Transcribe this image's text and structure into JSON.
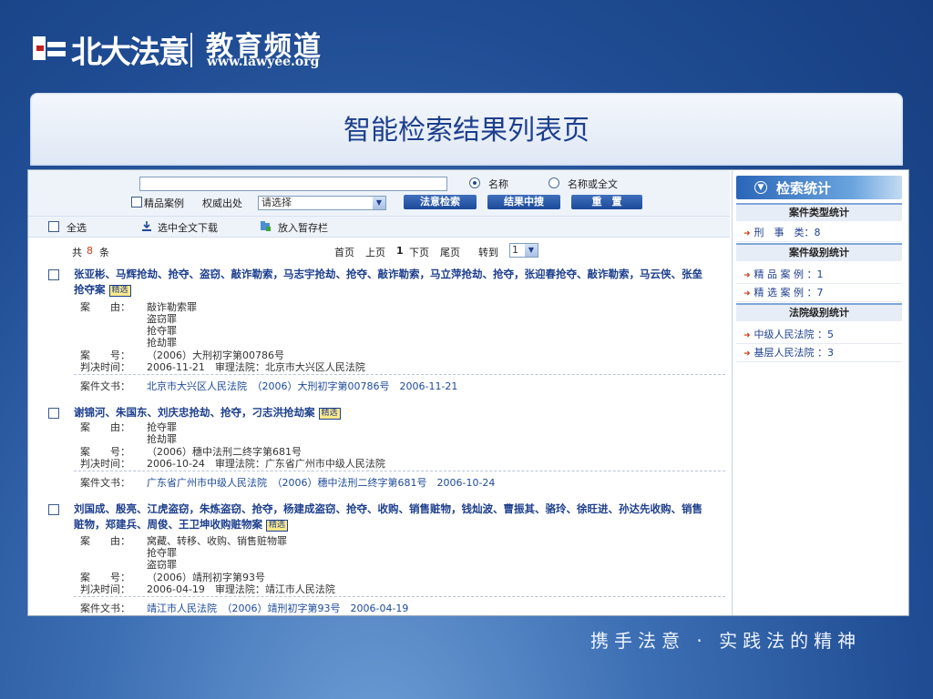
{
  "brand": {
    "name": "北大法意",
    "channel": "教育频道",
    "url": "www.lawyee.org"
  },
  "page_title": "智能检索结果列表页",
  "search": {
    "input_value": "",
    "radio_name": "名称",
    "radio_name_fulltext": "名称或全文",
    "premium_checkbox": "精品案例",
    "authority_label": "权威出处",
    "authority_select": "请选择",
    "btn_search": "法意检索",
    "btn_within": "结果中搜",
    "btn_reset": "重　置"
  },
  "toolbar": {
    "select_all": "全选",
    "download": "选中全文下载",
    "save": "放入暂存栏"
  },
  "pager": {
    "total_prefix": "共",
    "total": "8",
    "total_suffix": "条",
    "first": "首页",
    "prev": "上页",
    "current": "1",
    "next": "下页",
    "last": "尾页",
    "goto": "转到",
    "goto_value": "1"
  },
  "labels": {
    "cause": "案　　由：",
    "case_no": "案　　号：",
    "judge_time": "判决时间：",
    "court": "审理法院：",
    "document": "案件文书：",
    "tag": "精选"
  },
  "results": [
    {
      "title": "张亚彬、马辉抢劫、抢夺、盗窃、敲诈勒索，马志宇抢劫、抢夺、敲诈勒索，马立萍抢劫、抢夺，张迎春抢夺、敲诈勒索，马云侠、张垒抢夺案",
      "causes": [
        "敲诈勒索罪",
        "盗窃罪",
        "抢夺罪",
        "抢劫罪"
      ],
      "case_no": "（2006）大刑初字第00786号",
      "date": "2006-11-21",
      "court": "北京市大兴区人民法院",
      "doc": "北京市大兴区人民法院　（2006）大刑初字第00786号　2006-11-21"
    },
    {
      "title": "谢锦河、朱国东、刘庆忠抢劫、抢夺，刁志洪抢劫案",
      "causes": [
        "抢夺罪",
        "抢劫罪"
      ],
      "case_no": "（2006）穗中法刑二终字第681号",
      "date": "2006-10-24",
      "court": "广东省广州市中级人民法院",
      "doc": "广东省广州市中级人民法院　（2006）穗中法刑二终字第681号　2006-10-24"
    },
    {
      "title": "刘国成、殷亮、江虎盗窃，朱炼盗窃、抢夺，杨建成盗窃、抢夺、收购、销售赃物，钱灿波、曹振其、骆玲、徐旺进、孙达先收购、销售赃物，郑建兵、周俊、王卫坤收购赃物案",
      "causes": [
        "窝藏、转移、收购、销售赃物罪",
        "抢夺罪",
        "盗窃罪"
      ],
      "case_no": "（2006）靖刑初字第93号",
      "date": "2006-04-19",
      "court": "靖江市人民法院",
      "doc": "靖江市人民法院　（2006）靖刑初字第93号　2006-04-19"
    }
  ],
  "sidebar": {
    "header": "检索统计",
    "sections": [
      {
        "title": "案件类型统计",
        "items": [
          "刑　事　类：8"
        ]
      },
      {
        "title": "案件级别统计",
        "items": [
          "精 品 案 例 ：1",
          "精 选 案 例 ：7"
        ]
      },
      {
        "title": "法院级别统计",
        "items": [
          "中级人民法院 ：5",
          "基层人民法院 ：3"
        ]
      }
    ]
  },
  "slogan": "携手法意 · 实践法的精神"
}
